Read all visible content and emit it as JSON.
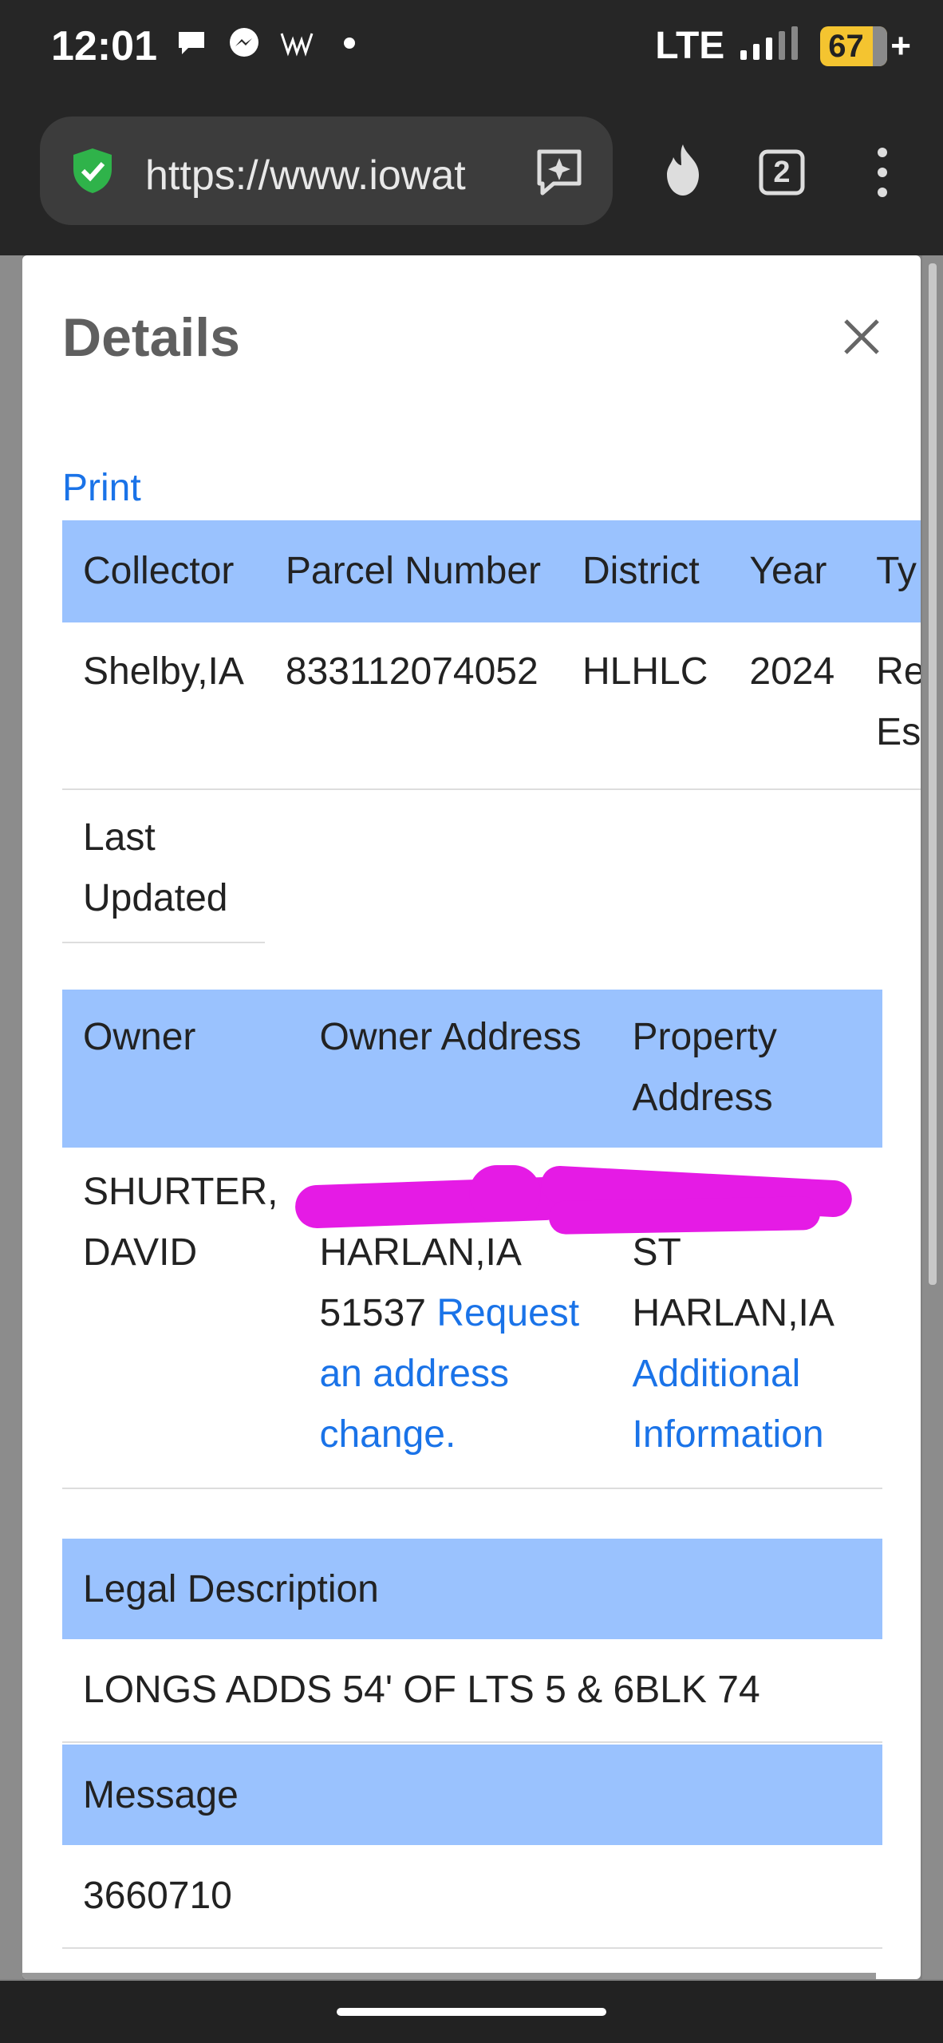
{
  "status": {
    "time": "12:01",
    "icons": [
      "chat-bubble-icon",
      "messenger-icon",
      "w-app-icon",
      "dot-icon"
    ],
    "network": "LTE",
    "battery": "67"
  },
  "browser": {
    "url": "https://www.iowat",
    "tab_count": "2"
  },
  "modal": {
    "title": "Details",
    "print_label": "Print",
    "summary_table": {
      "headers": [
        "Collector",
        "Parcel Number",
        "District",
        "Year",
        "Ty"
      ],
      "row": {
        "collector": "Shelby,IA",
        "parcel": "833112074052",
        "district": "HLHLC",
        "year": "2024",
        "type_line1": "Re",
        "type_line2": "Es"
      }
    },
    "last_updated_label": "Last Updated",
    "owner_table": {
      "headers": [
        "Owner",
        "Owner Address",
        "Property Address"
      ],
      "owner": "SHURTER, DAVID",
      "owner_city": "HARLAN,IA",
      "owner_zip": "51537",
      "request_link": "Request an address change.",
      "property_street": "ST",
      "property_city": "HARLAN,IA",
      "additional_link": "Additional Information"
    },
    "legal_table": {
      "header": "Legal Description",
      "value": "LONGS ADDS 54' OF LTS 5 & 6BLK 74"
    },
    "message_table": {
      "header": "Message",
      "value": "3660710"
    }
  },
  "colors": {
    "header_bg": "#9ac2fe",
    "link": "#1a73e8",
    "redaction": "#e51be5"
  }
}
